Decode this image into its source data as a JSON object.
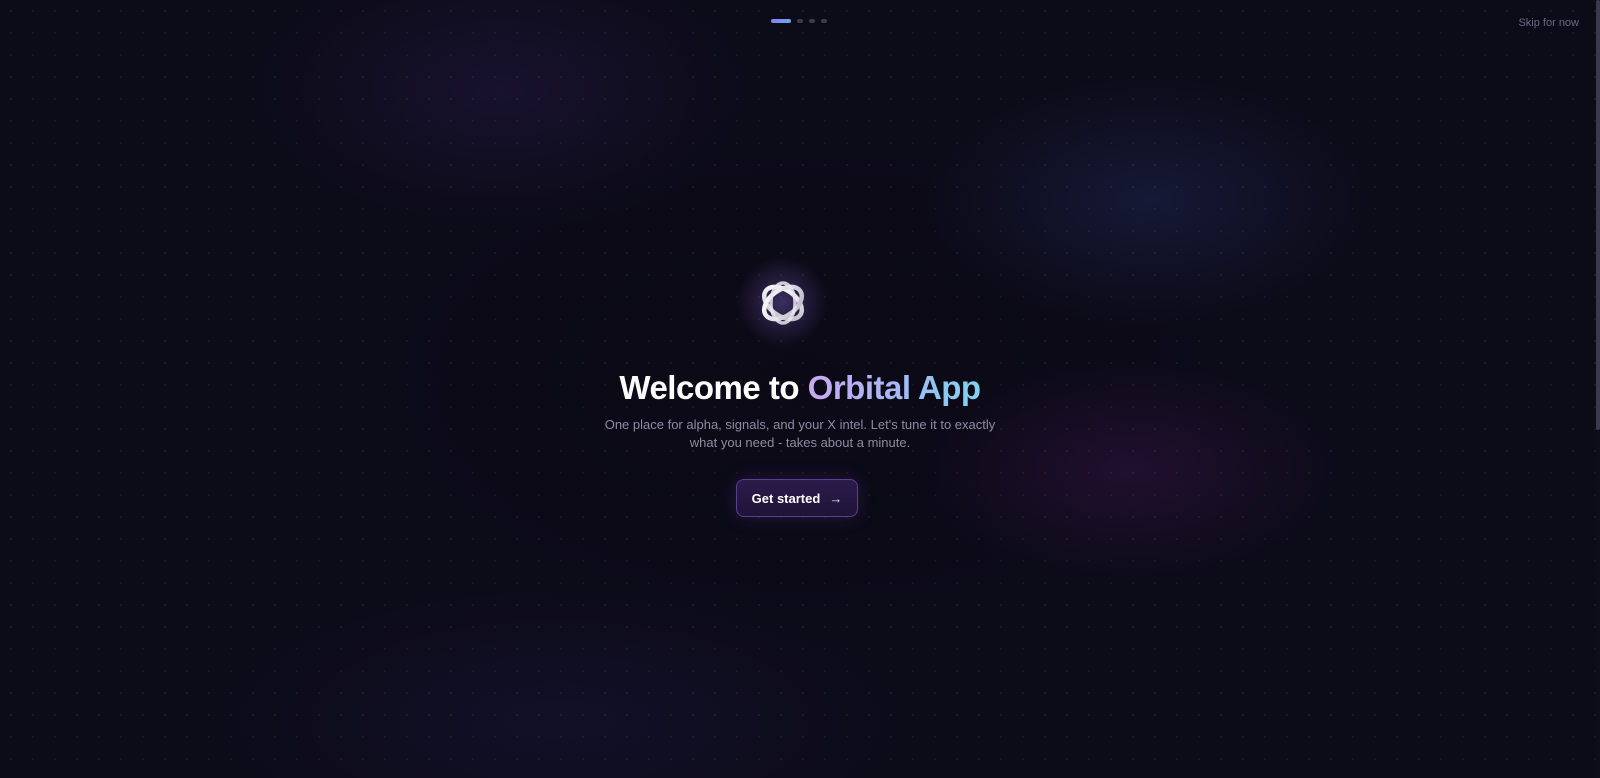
{
  "onboarding": {
    "progress": {
      "current_step": 1,
      "total_steps": 4
    },
    "skip_label": "Skip for now",
    "logo_icon": "orbital-rings-icon",
    "headline": {
      "prefix": "Welcome to ",
      "brand": "Orbital App"
    },
    "subtitle": "One place for alpha, signals, and your X intel. Let's tune it to exactly what you need - takes about a minute.",
    "cta": {
      "label": "Get started",
      "icon": "arrow-right-icon"
    }
  },
  "colors": {
    "background": "#0c0b18",
    "accent_purple": "#c9a8f2",
    "accent_cyan": "#7fd3ef",
    "progress_active": "#8b7cf6",
    "cta_border": "#5a3f93"
  }
}
